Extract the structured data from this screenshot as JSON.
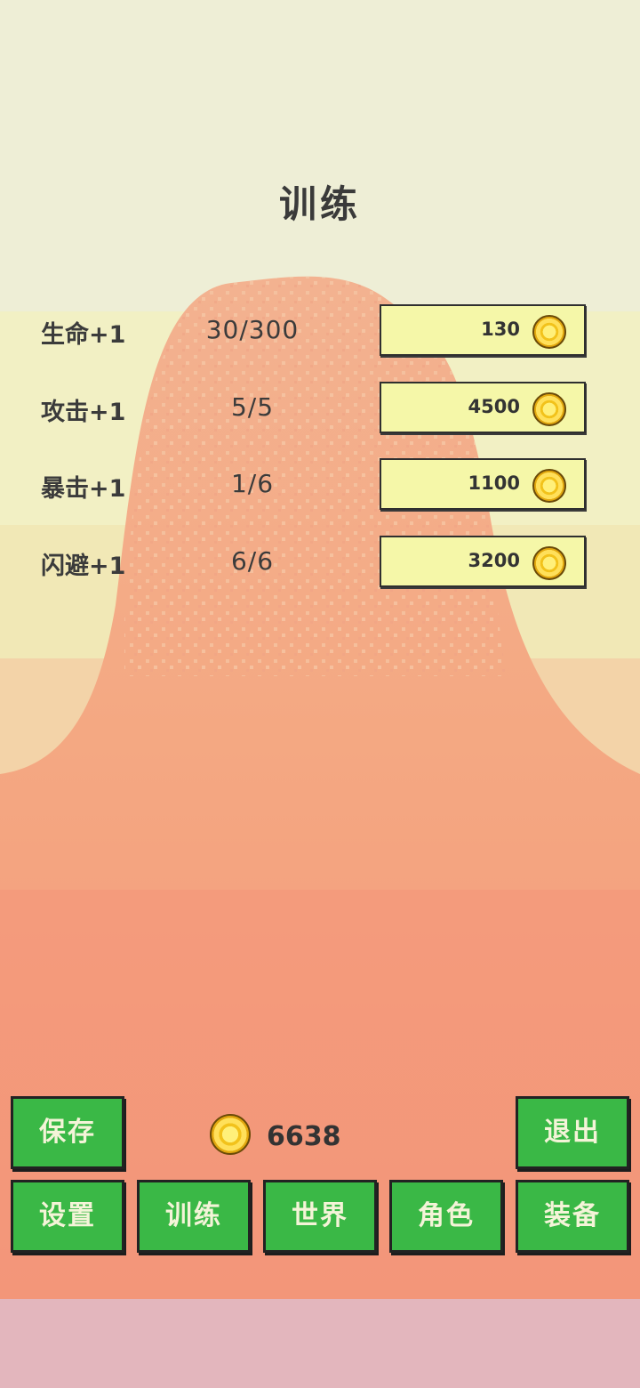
{
  "screen": {
    "title": "训练"
  },
  "colors": {
    "sky": "#eeeed6",
    "mountain": "#f2a07f",
    "ground": "#f39679",
    "button_green": "#3ab846",
    "cost_button": "#f5f7a8",
    "footer": "#e3b6bd"
  },
  "training": [
    {
      "name": "生命+1",
      "level": "30/300",
      "cost": "130",
      "icon": "gold-coin-icon"
    },
    {
      "name": "攻击+1",
      "level": "5/5",
      "cost": "4500",
      "icon": "gold-coin-icon"
    },
    {
      "name": "暴击+1",
      "level": "1/6",
      "cost": "1100",
      "icon": "gold-coin-icon"
    },
    {
      "name": "闪避+1",
      "level": "6/6",
      "cost": "3200",
      "icon": "gold-coin-icon"
    }
  ],
  "gold": {
    "amount": "6638",
    "icon": "gold-coin-icon"
  },
  "buttons": {
    "save": "保存",
    "exit": "退出",
    "settings": "设置",
    "training": "训练",
    "world": "世界",
    "character": "角色",
    "equipment": "装备"
  }
}
